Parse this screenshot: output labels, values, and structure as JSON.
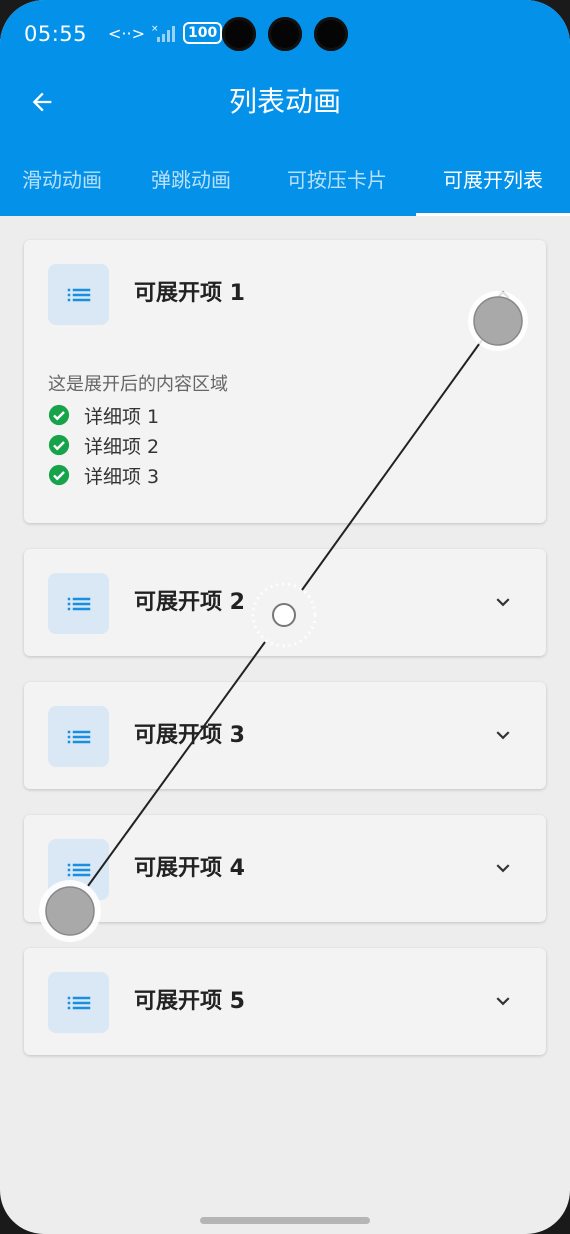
{
  "status_bar": {
    "time": "05:55",
    "signal_text": "<··>",
    "battery": "100"
  },
  "header": {
    "title": "列表动画",
    "back_icon": "arrow-left-icon"
  },
  "tabs": [
    {
      "label": "滑动动画",
      "active": false
    },
    {
      "label": "弹跳动画",
      "active": false
    },
    {
      "label": "可按压卡片",
      "active": false
    },
    {
      "label": "可展开列表",
      "active": true
    }
  ],
  "cards": [
    {
      "title": "可展开项 1",
      "expanded": true,
      "icon": "list-icon",
      "toggle_icon": "chevron-up-icon"
    },
    {
      "title": "可展开项 2",
      "expanded": false,
      "icon": "list-icon",
      "toggle_icon": "chevron-down-icon"
    },
    {
      "title": "可展开项 3",
      "expanded": false,
      "icon": "list-icon",
      "toggle_icon": "chevron-down-icon"
    },
    {
      "title": "可展开项 4",
      "expanded": false,
      "icon": "list-icon",
      "toggle_icon": "chevron-down-icon"
    },
    {
      "title": "可展开项 5",
      "expanded": false,
      "icon": "list-icon",
      "toggle_icon": "chevron-down-icon"
    }
  ],
  "expanded_content": {
    "label": "这是展开后的内容区域",
    "details": [
      "详细项 1",
      "详细项 2",
      "详细项 3"
    ],
    "check_icon": "check-circle-icon"
  },
  "colors": {
    "primary": "#0391ea",
    "check": "#17a34a",
    "icon": "#1a8fe0"
  }
}
